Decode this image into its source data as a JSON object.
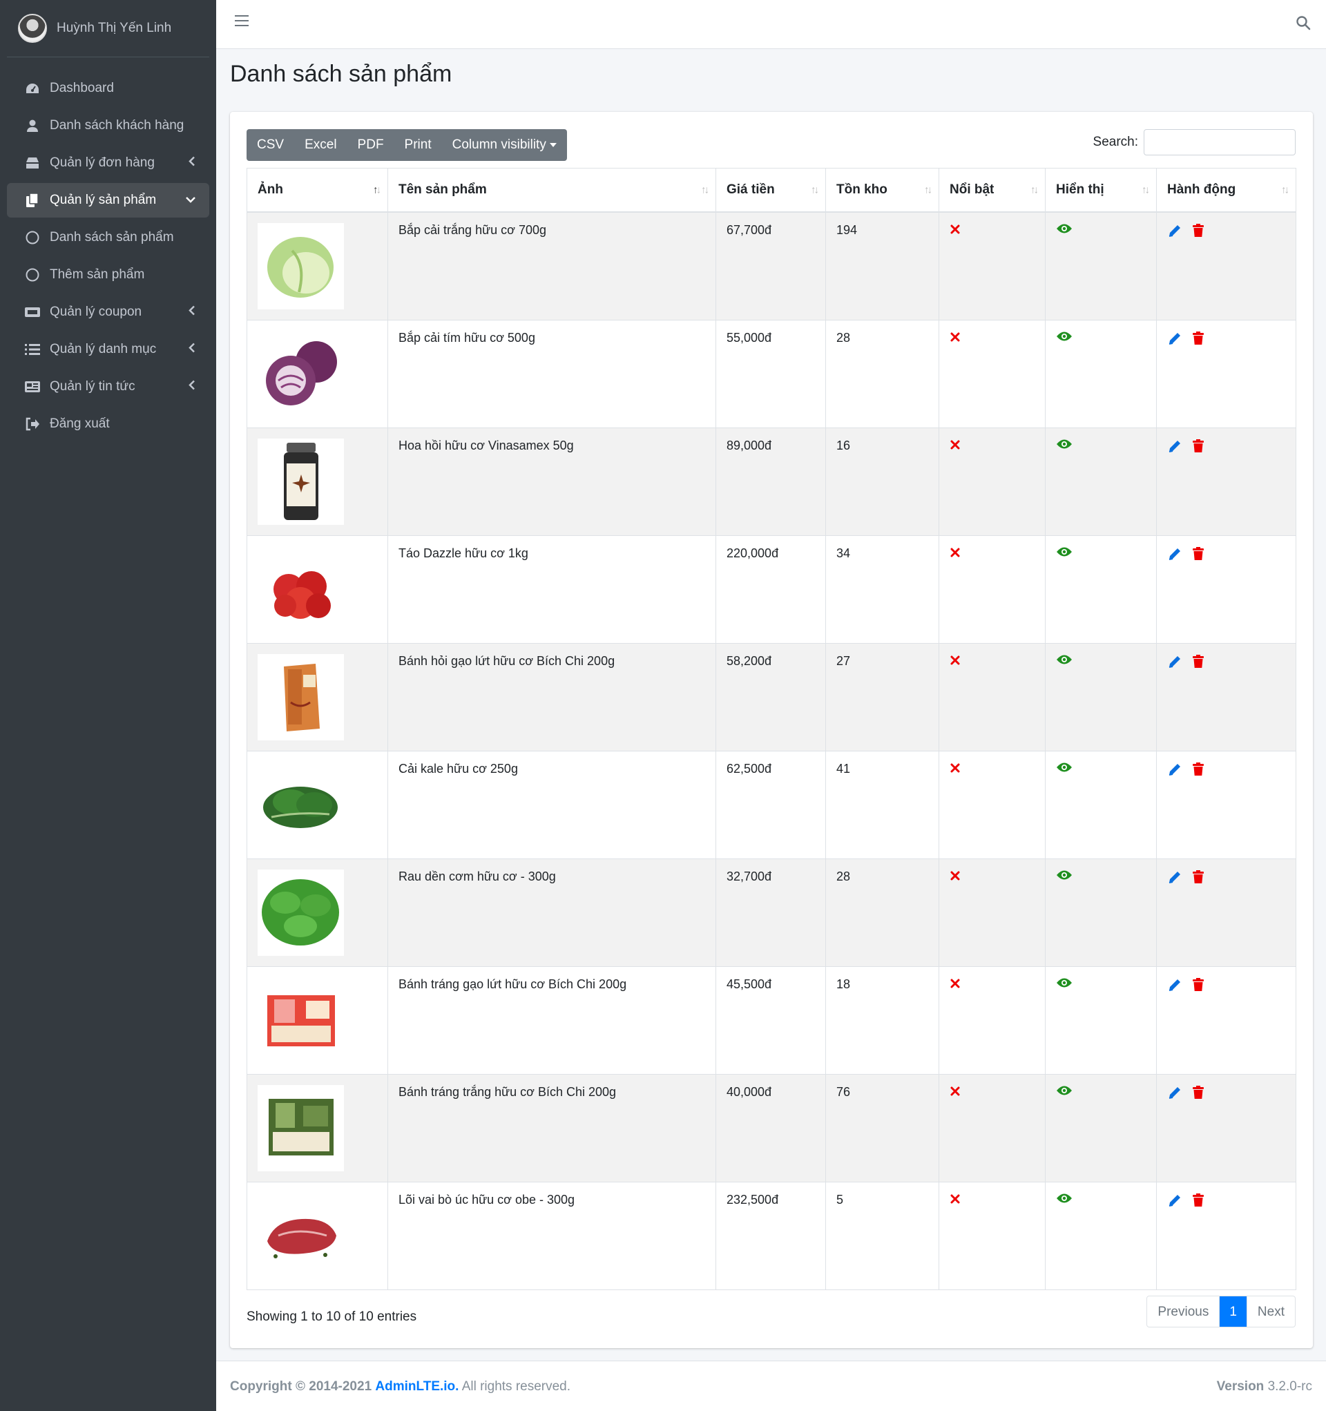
{
  "user": {
    "name": "Huỳnh Thị Yến Linh"
  },
  "sidebar": {
    "items": [
      {
        "label": "Dashboard",
        "icon": "tachometer-icon",
        "arrow": ""
      },
      {
        "label": "Danh sách khách hàng",
        "icon": "user-icon",
        "arrow": ""
      },
      {
        "label": "Quản lý đơn hàng",
        "icon": "inbox-icon",
        "arrow": "‹"
      },
      {
        "label": "Quản lý sản phẩm",
        "icon": "copy-icon",
        "arrow": "⌄",
        "active": true
      },
      {
        "label": "Danh sách sản phẩm",
        "icon": "circle-icon",
        "arrow": ""
      },
      {
        "label": "Thêm sản phẩm",
        "icon": "circle-icon",
        "arrow": ""
      },
      {
        "label": "Quản lý coupon",
        "icon": "ticket-icon",
        "arrow": "‹"
      },
      {
        "label": "Quản lý danh mục",
        "icon": "list-icon",
        "arrow": "‹"
      },
      {
        "label": "Quản lý tin tức",
        "icon": "newspaper-icon",
        "arrow": "‹"
      },
      {
        "label": "Đăng xuất",
        "icon": "sign-out-icon",
        "arrow": ""
      }
    ]
  },
  "page": {
    "title": "Danh sách sản phẩm"
  },
  "toolbar": {
    "csv": "CSV",
    "excel": "Excel",
    "pdf": "PDF",
    "print": "Print",
    "colvis": "Column visibility"
  },
  "search": {
    "label": "Search:",
    "value": ""
  },
  "table": {
    "headers": [
      "Ảnh",
      "Tên sản phẩm",
      "Giá tiền",
      "Tồn kho",
      "Nổi bật",
      "Hiển thị",
      "Hành động"
    ],
    "rows": [
      {
        "name": "Bắp cải trắng hữu cơ 700g",
        "price": "67,700đ",
        "stock": "194",
        "img": "cabbage-white"
      },
      {
        "name": "Bắp cải tím hữu cơ 500g",
        "price": "55,000đ",
        "stock": "28",
        "img": "cabbage-purple"
      },
      {
        "name": "Hoa hồi hữu cơ Vinasamex 50g",
        "price": "89,000đ",
        "stock": "16",
        "img": "spice-jar"
      },
      {
        "name": "Táo Dazzle hữu cơ 1kg",
        "price": "220,000đ",
        "stock": "34",
        "img": "apples"
      },
      {
        "name": "Bánh hỏi gạo lứt hữu cơ Bích Chi 200g",
        "price": "58,200đ",
        "stock": "27",
        "img": "box-orange"
      },
      {
        "name": "Cải kale hữu cơ 250g",
        "price": "62,500đ",
        "stock": "41",
        "img": "kale"
      },
      {
        "name": "Rau dền cơm hữu cơ - 300g",
        "price": "32,700đ",
        "stock": "28",
        "img": "greens"
      },
      {
        "name": "Bánh tráng gạo lứt hữu cơ Bích Chi 200g",
        "price": "45,500đ",
        "stock": "18",
        "img": "box-red"
      },
      {
        "name": "Bánh tráng trắng hữu cơ Bích Chi 200g",
        "price": "40,000đ",
        "stock": "76",
        "img": "box-green"
      },
      {
        "name": "Lõi vai bò úc hữu cơ obe - 300g",
        "price": "232,500đ",
        "stock": "5",
        "img": "beef"
      }
    ]
  },
  "pagination": {
    "info": "Showing 1 to 10 of 10 entries",
    "prev": "Previous",
    "current": "1",
    "next": "Next"
  },
  "footer": {
    "copyright": "Copyright © 2014-2021",
    "brand": "AdminLTE.io.",
    "rights": "All rights reserved.",
    "version_label": "Version",
    "version": "3.2.0-rc"
  },
  "colors": {
    "sidebar_bg": "#343a40",
    "primary": "#007bff",
    "danger": "#e00000",
    "success": "#1f8f1f"
  }
}
